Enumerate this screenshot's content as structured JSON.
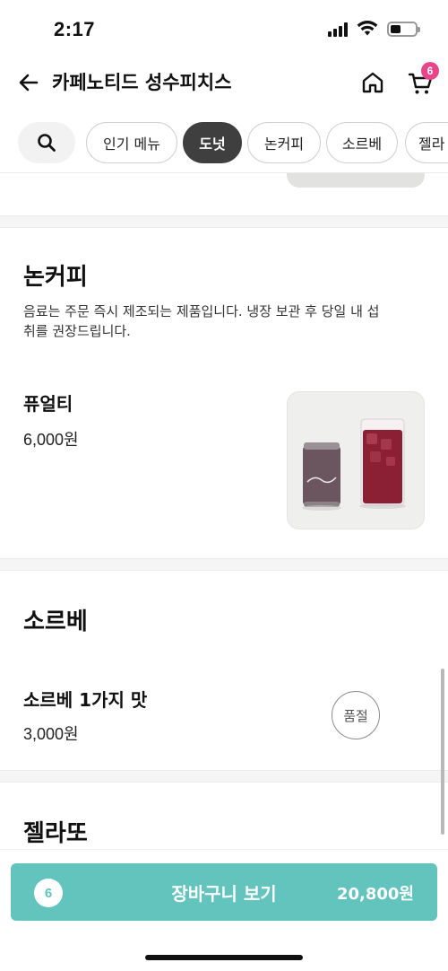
{
  "status_bar": {
    "time": "2:17"
  },
  "header": {
    "title": "카페노티드 성수피치스",
    "cart_count": "6"
  },
  "categories": [
    {
      "label": "인기 메뉴",
      "active": false
    },
    {
      "label": "도넛",
      "active": true
    },
    {
      "label": "논커피",
      "active": false
    },
    {
      "label": "소르베",
      "active": false
    },
    {
      "label": "젤라",
      "active": false
    }
  ],
  "sections": {
    "noncoffee": {
      "title": "논커피",
      "description": "음료는 주문 즉시 제조되는 제품입니다. 냉장 보관 후 당일 내 섭취를 권장드립니다.",
      "description_line1": "음료는 주문 즉시 제조되는 제품입니다. 냉장 보관 후 당일 내 섭",
      "description_line2": "취를 권장드립니다.",
      "items": [
        {
          "name": "퓨얼티",
          "price": "6,000원",
          "sold_out": false
        }
      ]
    },
    "sorbet": {
      "title": "소르베",
      "items": [
        {
          "name": "소르베 1가지 맛",
          "price": "3,000원",
          "sold_out": true,
          "sold_out_label": "품절"
        }
      ]
    },
    "gelato": {
      "title": "젤라또"
    }
  },
  "cart_bar": {
    "count": "6",
    "label": "장바구니 보기",
    "total": "20,800원"
  },
  "colors": {
    "accent": "#63c3bd",
    "badge": "#e8458b",
    "chip_active": "#3f3f3f"
  },
  "icons": [
    "back-arrow-icon",
    "home-icon",
    "cart-icon",
    "search-icon"
  ]
}
